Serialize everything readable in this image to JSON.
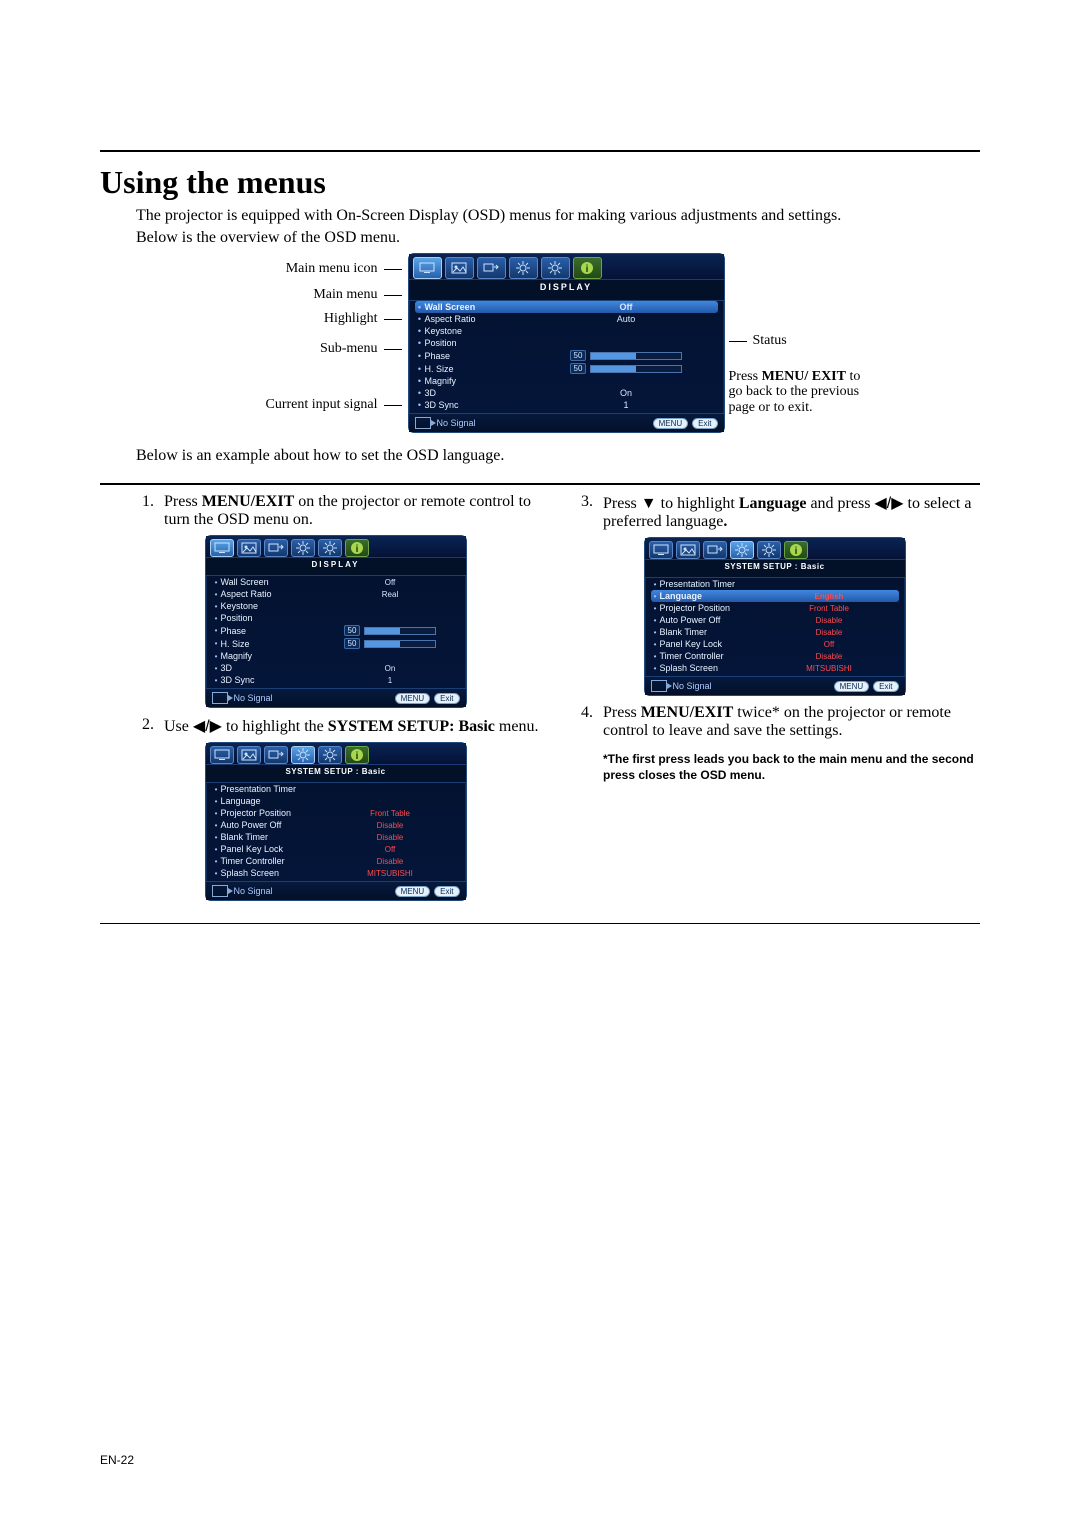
{
  "title": "Using the menus",
  "intro1": "The projector is equipped with On-Screen Display (OSD) menus for making various adjustments and settings.",
  "intro2": "Below is the overview of the OSD menu.",
  "labels": {
    "main_icon": "Main menu icon",
    "main_menu": "Main menu",
    "highlight": "Highlight",
    "sub_menu": "Sub-menu",
    "cur_signal": "Current input signal",
    "status": "Status",
    "press_note_pre": "Press ",
    "press_note_bold": "MENU/ EXIT",
    "press_note_post": " to go back to the previous page or to exit."
  },
  "osd_common": {
    "no_signal": "No Signal",
    "menu_chip": "MENU",
    "exit_chip": "Exit"
  },
  "osd_display": {
    "title": "DISPLAY",
    "rows": [
      {
        "label": "Wall Screen",
        "val": "Off",
        "hl": true,
        "type": "text"
      },
      {
        "label": "Aspect Ratio",
        "val": "Auto",
        "type": "text"
      },
      {
        "label": "Keystone",
        "val": "",
        "type": "text"
      },
      {
        "label": "Position",
        "val": "",
        "type": "text"
      },
      {
        "label": "Phase",
        "val": "50",
        "type": "slider"
      },
      {
        "label": "H. Size",
        "val": "50",
        "type": "slider"
      },
      {
        "label": "Magnify",
        "val": "",
        "type": "text"
      },
      {
        "label": "3D",
        "val": "On",
        "type": "text"
      },
      {
        "label": "3D Sync",
        "val": "1",
        "type": "text"
      }
    ]
  },
  "step_intro": "Below is an example about how to set the OSD language.",
  "steps": {
    "s1_pre": "Press ",
    "s1_bold": "MENU/EXIT",
    "s1_post": " on the projector or remote control to turn the OSD menu on.",
    "s2_pre": "Use ",
    "s2_mid": " to highlight the ",
    "s2_bold": "SYSTEM SETUP: Basic",
    "s2_post": " menu.",
    "s3_pre": "Press ",
    "s3_mid1": " to highlight ",
    "s3_bold1": "Language",
    "s3_mid2": " and press ",
    "s3_post": " to select a preferred language",
    "s3_dot": ".",
    "s4_pre": "Press ",
    "s4_bold": "MENU/EXIT",
    "s4_post": " twice* on the projector or remote control to leave and save the settings.",
    "note": "*The first press leads you back to the main menu and the second press closes the OSD menu."
  },
  "osd_step1": {
    "title": "DISPLAY",
    "rows": [
      {
        "label": "Wall Screen",
        "val": "Off",
        "type": "text"
      },
      {
        "label": "Aspect Ratio",
        "val": "Real",
        "type": "text"
      },
      {
        "label": "Keystone",
        "val": "",
        "type": "text"
      },
      {
        "label": "Position",
        "val": "",
        "type": "text"
      },
      {
        "label": "Phase",
        "val": "50",
        "type": "slider"
      },
      {
        "label": "H. Size",
        "val": "50",
        "type": "slider"
      },
      {
        "label": "Magnify",
        "val": "",
        "type": "text"
      },
      {
        "label": "3D",
        "val": "On",
        "type": "text"
      },
      {
        "label": "3D Sync",
        "val": "1",
        "type": "text"
      }
    ]
  },
  "osd_system_title": "SYSTEM SETUP : Basic",
  "osd_step2": {
    "rows": [
      {
        "label": "Presentation Timer",
        "val": "",
        "type": "text"
      },
      {
        "label": "Language",
        "val": "",
        "type": "text"
      },
      {
        "label": "Projector Position",
        "val": "Front Table",
        "type": "red"
      },
      {
        "label": "Auto Power Off",
        "val": "Disable",
        "type": "red"
      },
      {
        "label": "Blank Timer",
        "val": "Disable",
        "type": "red"
      },
      {
        "label": "Panel Key Lock",
        "val": "Off",
        "type": "red"
      },
      {
        "label": "Timer Controller",
        "val": "Disable",
        "type": "red"
      },
      {
        "label": "Splash Screen",
        "val": "MITSUBISHI",
        "type": "red"
      }
    ]
  },
  "osd_step3": {
    "rows": [
      {
        "label": "Presentation Timer",
        "val": "",
        "type": "text"
      },
      {
        "label": "Language",
        "val": "English",
        "hl": true,
        "type": "red"
      },
      {
        "label": "Projector Position",
        "val": "Front Table",
        "type": "red"
      },
      {
        "label": "Auto Power Off",
        "val": "Disable",
        "type": "red"
      },
      {
        "label": "Blank Timer",
        "val": "Disable",
        "type": "red"
      },
      {
        "label": "Panel Key Lock",
        "val": "Off",
        "type": "red"
      },
      {
        "label": "Timer Controller",
        "val": "Disable",
        "type": "red"
      },
      {
        "label": "Splash Screen",
        "val": "MITSUBISHI",
        "type": "red"
      }
    ]
  },
  "arrows": {
    "left": "◀",
    "right": "▶",
    "down": "▼",
    "slash": "/"
  },
  "page_num": "EN-22"
}
